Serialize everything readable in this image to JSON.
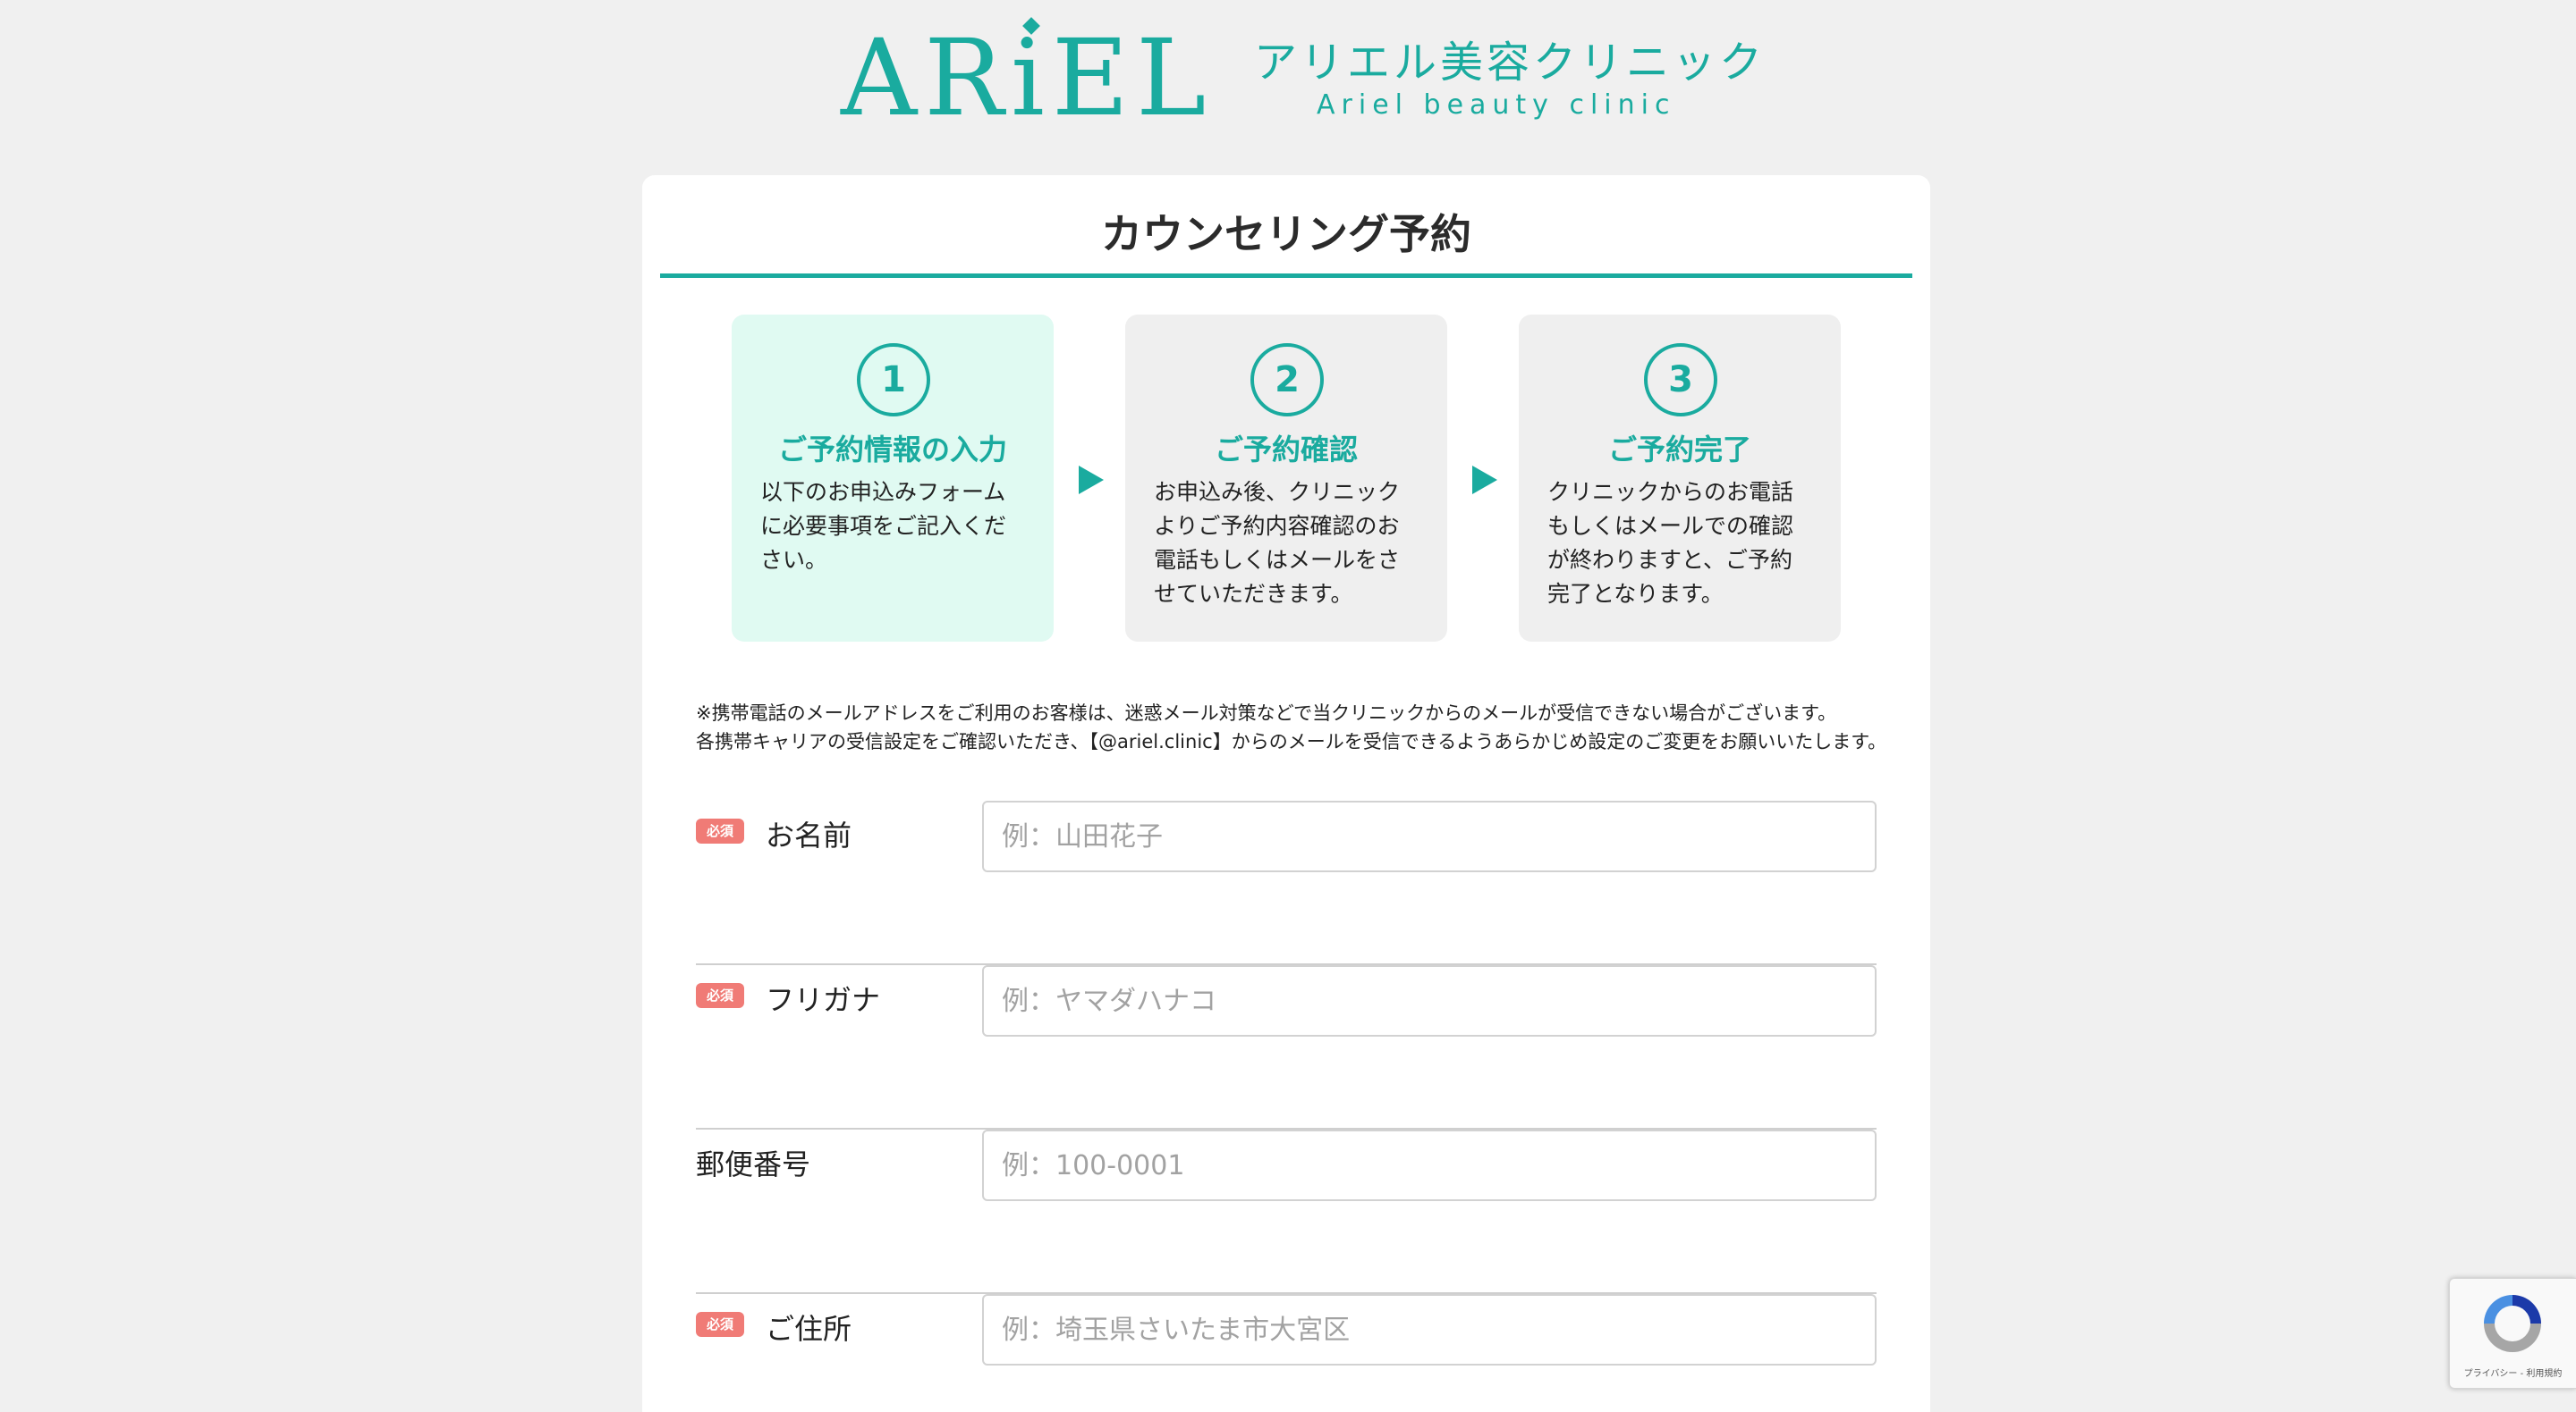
{
  "brand": {
    "mark": "ARiEL",
    "name_ja": "アリエル美容クリニック",
    "name_en": "Ariel beauty clinic",
    "accent_color": "#1aab9f"
  },
  "card": {
    "title": "カウンセリング予約"
  },
  "steps": [
    {
      "number": "1",
      "title": "ご予約情報の入力",
      "description": "以下のお申込みフォームに必要事項をご記入ください。",
      "state": "active"
    },
    {
      "number": "2",
      "title": "ご予約確認",
      "description": "お申込み後、クリニックよりご予約内容確認のお電話もしくはメールをさせていただきます。",
      "state": "inactive"
    },
    {
      "number": "3",
      "title": "ご予約完了",
      "description": "クリニックからのお電話もしくはメールでの確認が終わりますと、ご予約完了となります。",
      "state": "inactive"
    }
  ],
  "notice": {
    "line1": "※携帯電話のメールアドレスをご利用のお客様は、迷惑メール対策などで当クリニックからのメールが受信できない場合がございます。",
    "line2": "各携帯キャリアの受信設定をご確認いただき、【@ariel.clinic】からのメールを受信できるようあらかじめ設定のご変更をお願いいたします。"
  },
  "form": {
    "required_badge": "必須",
    "fields": [
      {
        "label": "お名前",
        "placeholder": "例：山田花子",
        "value": "",
        "required": true
      },
      {
        "label": "フリガナ",
        "placeholder": "例：ヤマダハナコ",
        "value": "",
        "required": true
      },
      {
        "label": "郵便番号",
        "placeholder": "例：100-0001",
        "value": "",
        "required": false
      },
      {
        "label": "ご住所",
        "placeholder": "例：埼玉県さいたま市大宮区",
        "value": "",
        "required": true
      }
    ]
  },
  "recaptcha": {
    "links": "プライバシー - 利用規約",
    "icon": "recaptcha-logo"
  }
}
